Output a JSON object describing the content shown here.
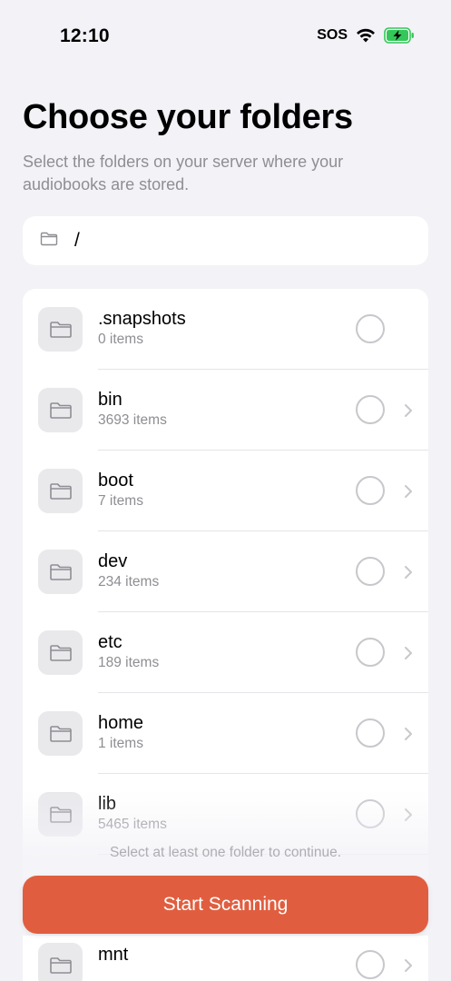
{
  "status": {
    "time": "12:10",
    "sos": "SOS"
  },
  "header": {
    "title": "Choose your folders",
    "subtitle": "Select the folders on your server where your audiobooks are stored."
  },
  "path": {
    "current": "/"
  },
  "folders": [
    {
      "name": ".snapshots",
      "count": "0 items",
      "has_chevron": false
    },
    {
      "name": "bin",
      "count": "3693 items",
      "has_chevron": true
    },
    {
      "name": "boot",
      "count": "7 items",
      "has_chevron": true
    },
    {
      "name": "dev",
      "count": "234 items",
      "has_chevron": true
    },
    {
      "name": "etc",
      "count": "189 items",
      "has_chevron": true
    },
    {
      "name": "home",
      "count": "1 items",
      "has_chevron": true
    },
    {
      "name": "lib",
      "count": "5465 items",
      "has_chevron": true
    },
    {
      "name": "mnt",
      "count": "",
      "has_chevron": true
    }
  ],
  "footer": {
    "hint": "Select at least one folder to continue.",
    "button_label": "Start Scanning"
  },
  "colors": {
    "accent": "#e05e3f",
    "background": "#f2f2f7",
    "secondary_text": "#8e8e93"
  },
  "icons": [
    "wifi-icon",
    "battery-charging-icon",
    "folder-icon",
    "chevron-right-icon"
  ]
}
